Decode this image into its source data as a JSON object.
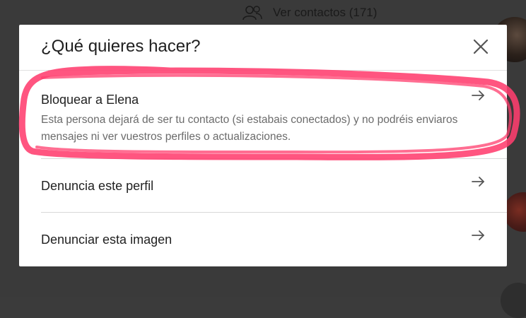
{
  "background": {
    "contacts_link": "Ver contactos (171)"
  },
  "modal": {
    "title": "¿Qué quieres hacer?",
    "options": [
      {
        "title": "Bloquear a Elena",
        "description": "Esta persona dejará de ser tu contacto (si estabais conectados) y no podréis enviaros mensajes ni ver vuestros perfiles o actualizaciones."
      },
      {
        "title": "Denuncia este perfil"
      },
      {
        "title": "Denunciar esta imagen"
      }
    ]
  },
  "colors": {
    "overlay": "#3a3a3a",
    "modal_bg": "#ffffff",
    "highlight_stroke": "#ff3d6e",
    "title_text": "#1f1f1f",
    "description_text": "#6b6b6b"
  },
  "icons": {
    "close": "close-icon",
    "arrow": "arrow-right-icon",
    "contacts": "people-icon"
  }
}
